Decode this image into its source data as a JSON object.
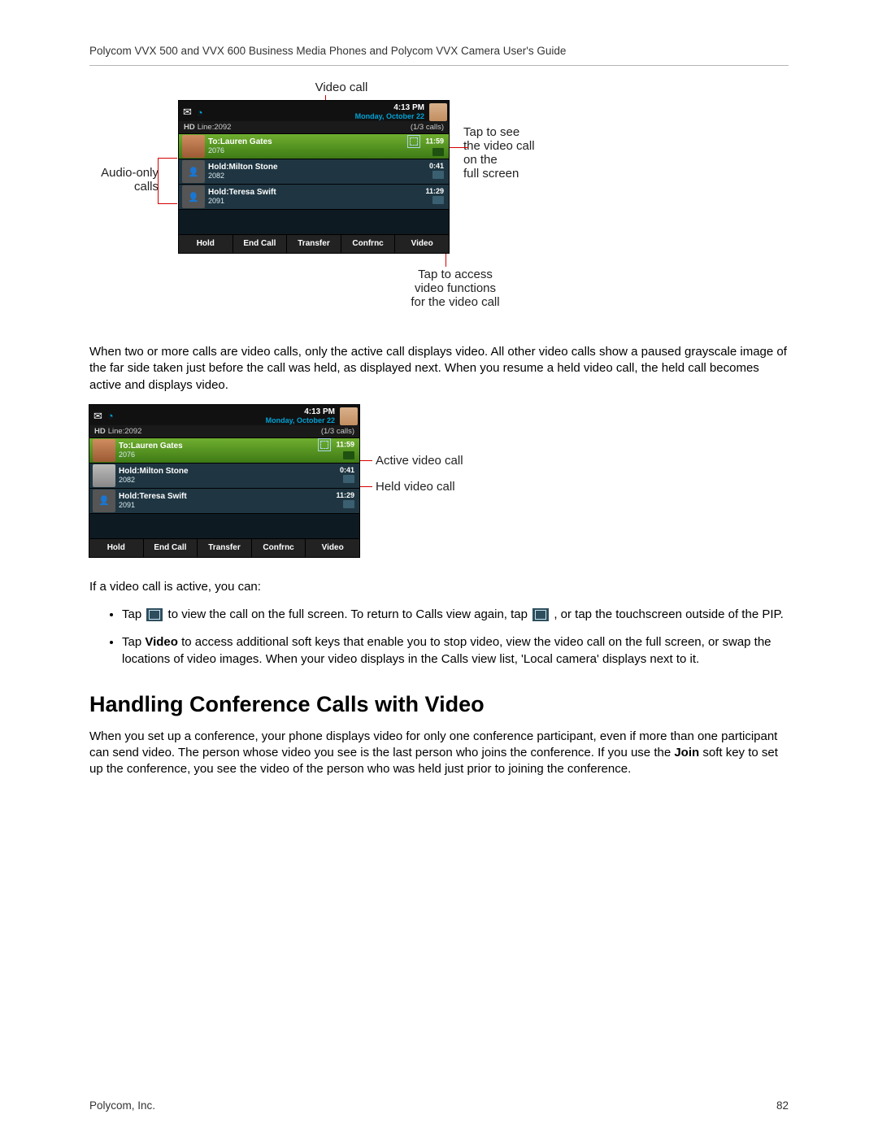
{
  "header": "Polycom VVX 500 and VVX 600 Business Media Phones and Polycom VVX Camera User's Guide",
  "fig1": {
    "label_videocall": "Video call",
    "label_audio_only": "Audio-only\ncalls",
    "label_tap_fullscreen": "Tap to see\nthe video call\non the\nfull screen",
    "label_tap_access": "Tap to access\nvideo functions\nfor the video call"
  },
  "phone": {
    "time": "4:13 PM",
    "date": "Monday, October 22",
    "line_label": "Line:2092",
    "hd_label": "HD",
    "call_count": "(1/3 calls)",
    "calls": [
      {
        "prefix": "To:",
        "name": "Lauren Gates",
        "ext": "2076",
        "time": "11:59",
        "active": true
      },
      {
        "prefix": "Hold:",
        "name": "Milton Stone",
        "ext": "2082",
        "time": "0:41",
        "active": false
      },
      {
        "prefix": "Hold:",
        "name": "Teresa Swift",
        "ext": "2091",
        "time": "11:29",
        "active": false
      }
    ],
    "softkeys": [
      "Hold",
      "End Call",
      "Transfer",
      "Confrnc",
      "Video"
    ]
  },
  "para1": "When two or more calls are video calls, only the active call displays video. All other video calls show a paused grayscale image of the far side taken just before the call was held, as displayed next. When you resume a held video call, the held call becomes active and displays video.",
  "fig2": {
    "label_active": "Active video call",
    "label_held": "Held video call"
  },
  "para2_intro": "If a video call is active, you can:",
  "bullet1a": "Tap ",
  "bullet1b": " to view the call on the full screen. To return to Calls view again, tap ",
  "bullet1c": ", or tap the touchscreen outside of the PIP.",
  "bullet2a": "Tap ",
  "bullet2_bold": "Video",
  "bullet2b": " to access additional soft keys that enable you to stop video, view the video call on the full screen, or swap the locations of video images. When your video displays in the Calls view list, 'Local camera' displays next to it.",
  "section_heading": "Handling Conference Calls with Video",
  "para3a": "When you set up a conference, your phone displays video for only one conference participant, even if more than one participant can send video. The person whose video you see is the last person who joins the conference. If you use the ",
  "para3_bold": "Join",
  "para3b": " soft key to set up the conference, you see the video of the person who was held just prior to joining the conference.",
  "footer_company": "Polycom, Inc.",
  "footer_page": "82"
}
